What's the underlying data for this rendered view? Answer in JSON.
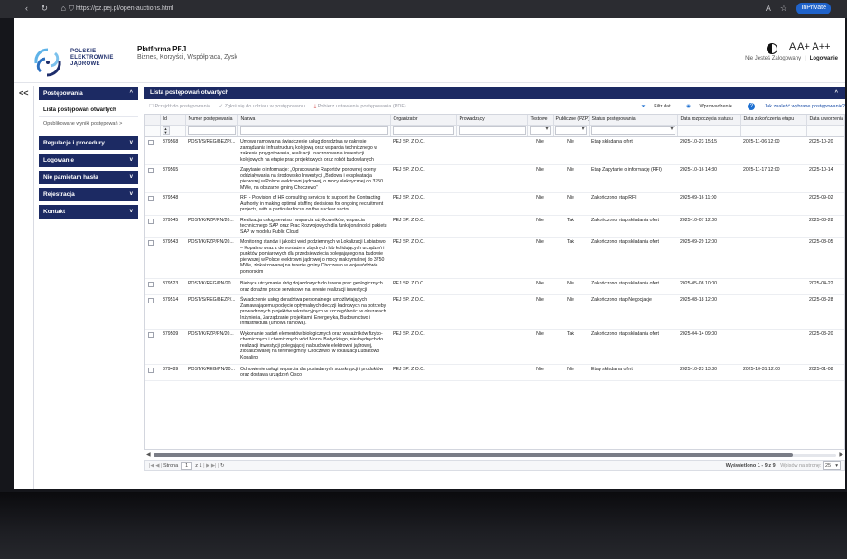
{
  "browser": {
    "url": "https://pz.pej.pl/open-auctions.html",
    "inprivate": "InPrivate"
  },
  "header": {
    "logo_text": "POLSKIE\nELEKTROWNIE\nJĄDROWE",
    "title": "Platforma PEJ",
    "subtitle": "Biznes, Korzyści, Współpraca, Zysk",
    "font_controls": "A A+ A++",
    "login_status": "Nie Jesteś Zalogowany",
    "login_link": "Logowanie"
  },
  "sidebar": {
    "collapse": "<<",
    "sections": [
      {
        "label": "Postępowania",
        "chevron": "^",
        "items": [
          "Lista postępowań otwartych"
        ],
        "sub": "Opublikowane wyniki postępowań >"
      },
      {
        "label": "Regulacje i procedury",
        "chevron": "v"
      },
      {
        "label": "Logowanie",
        "chevron": "v"
      },
      {
        "label": "Nie pamiętam hasła",
        "chevron": "v"
      },
      {
        "label": "Rejestracja",
        "chevron": "v"
      },
      {
        "label": "Kontakt",
        "chevron": "v"
      }
    ]
  },
  "panel": {
    "title": "Lista postępowań otwartych",
    "toolbar": {
      "goto": "Przejdź do postępowania",
      "join": "Zgłoś się do udziału w postępowaniu",
      "download": "Pobierz ustawienia postępowania (PDF)",
      "filter": "Filtr dat",
      "intro": "Wprowadzenie",
      "help": "Jak znaleźć wybrane postępowanie?"
    },
    "columns": [
      "Id",
      "Numer postępowania",
      "Nazwa",
      "Organizator",
      "Prowadzący",
      "Testowe",
      "Publiczne (PZP)",
      "Status postępowania",
      "Data rozpoczęcia statusu",
      "Data zakończenia etapu",
      "Data utworzenia"
    ],
    "rows": [
      {
        "id": "379568",
        "numer": "POST/S/REG/BEZP/...",
        "nazwa": "Umowa ramowa na świadczenie usług doradztwa w zakresie zarządzania infrastrukturą kolejową oraz wsparcia technicznego w zakresie przygotowania, realizacji i nadzorowania inwestycji kolejowych na etapie prac projektowych oraz robót budowlanych",
        "org": "PEJ SP. Z O.O.",
        "test": "Nie",
        "pub": "Nie",
        "status": "Etap składania ofert",
        "start": "2025-10-23 15:15",
        "end": "2025-11-06 12:00",
        "created": "2025-10-20"
      },
      {
        "id": "379565",
        "numer": "",
        "nazwa": "Zapytanie o informacje: „Opracowanie Raportów ponownej oceny oddziaływania na środowisko Inwestycji „Budowa i eksploatacja pierwszej w Polsce elektrowni jądrowej, o mocy elektrycznej do 3750 MWe, na obszarze gminy Choczewo”",
        "org": "PEJ SP. Z O.O.",
        "test": "Nie",
        "pub": "Nie",
        "status": "Etap Zapytanie o informację (RFI)",
        "start": "2025-10-16 14:30",
        "end": "2025-11-17 12:00",
        "created": "2025-10-14"
      },
      {
        "id": "379548",
        "numer": "",
        "nazwa": "RFI - Provision of HR consulting services to support the Contracting Authority in making optimal staffing decisions for ongoing recruitment projects, with a particular focus on the nuclear sector",
        "org": "PEJ SP. Z O.O.",
        "test": "Nie",
        "pub": "Nie",
        "status": "Zakończono etap RFI",
        "start": "2025-09-16 11:00",
        "end": "",
        "created": "2025-09-02"
      },
      {
        "id": "379545",
        "numer": "POST/K/PZP/PN/20...",
        "nazwa": "Realizacja usług serwisu i wsparcia użytkowników, wsparcia technicznego SAP oraz Prac Rozwojowych dla funkcjonalności pakietu SAP w modelu Public Cloud",
        "org": "PEJ SP. Z O.O.",
        "test": "Nie",
        "pub": "Tak",
        "status": "Zakończono etap składania ofert",
        "start": "2025-10-07 12:00",
        "end": "",
        "created": "2025-08-28"
      },
      {
        "id": "379543",
        "numer": "POST/K/PZP/PN/20...",
        "nazwa": "Monitoring stanów i jakości wód podziemnych w Lokalizacji Lubiatowo – Kopalino wraz z demontażem zbędnych lub kolidujących urządzeń i punktów pomiarowych dla przedsięwzięcia polegającego na budowie pierwszej w Polsce elektrowni jądrowej o mocy maksymalnej do 3750 MWe, zlokalizowanej na terenie gminy Choczewo w województwie pomorskim",
        "org": "PEJ SP. Z O.O.",
        "test": "Nie",
        "pub": "Tak",
        "status": "Zakończono etap składania ofert",
        "start": "2025-09-29 12:00",
        "end": "",
        "created": "2025-08-05"
      },
      {
        "id": "379523",
        "numer": "POST/K/REG/PN/20...",
        "nazwa": "Bieżące utrzymanie dróg dojazdowych do terenu prac geologicznych oraz doraźne prace serwisowe na terenie realizacji inwestycji",
        "org": "PEJ SP. Z O.O.",
        "test": "Nie",
        "pub": "Nie",
        "status": "Zakończono etap składania ofert",
        "start": "2025-05-08 10:00",
        "end": "",
        "created": "2025-04-22"
      },
      {
        "id": "379514",
        "numer": "POST/S/REG/BEZP/...",
        "nazwa": "Świadczenie usług doradztwa personalnego umożliwiających Zamawiającemu podjęcie optymalnych decyzji kadrowych na potrzeby prowadzonych projektów rekrutacyjnych w szczególności w obszarach Inżynieria, Zarządzanie projektami, Energetyka, Budownictwo i Infrastruktura (umowa ramowa).",
        "org": "PEJ SP. Z O.O.",
        "test": "Nie",
        "pub": "Nie",
        "status": "Zakończono etap Negocjacje",
        "start": "2025-08-18 12:00",
        "end": "",
        "created": "2025-03-28"
      },
      {
        "id": "379509",
        "numer": "POST/K/PZP/PN/20...",
        "nazwa": "Wykonanie badań elementów biologicznych oraz wskaźników fizyko-chemicznych i chemicznych wód Morza Bałtyckiego, niezbędnych do realizacji inwestycji polegającej na budowie elektrowni jądrowej, zlokalizowanej na terenie gminy Choczewo, w lokalizacji Lubiatowo Kopalino",
        "org": "PEJ SP. Z O.O.",
        "test": "Nie",
        "pub": "Tak",
        "status": "Zakończono etap składania ofert",
        "start": "2025-04-14 09:00",
        "end": "",
        "created": "2025-03-20"
      },
      {
        "id": "379489",
        "numer": "POST/K/REG/PN/20...",
        "nazwa": "Odnowienie usługi wsparcia dla posiadanych subskrypcji i produktów oraz dostawa urządzeń Cisco",
        "org": "PEJ SP. Z O.O.",
        "test": "Nie",
        "pub": "Nie",
        "status": "Etap składania ofert",
        "start": "2025-10-23 13:30",
        "end": "2025-10-31 12:00",
        "created": "2025-01-08"
      }
    ],
    "pager": {
      "page_label": "Strona",
      "page": "1",
      "of": "z 1",
      "summary": "Wyświetlono 1 - 9 z 9",
      "per_page_label": "Wpisów na stronę:",
      "per_page": "25"
    }
  },
  "colors": {
    "navy": "#1c2a63",
    "accent": "#1c6fd1"
  }
}
